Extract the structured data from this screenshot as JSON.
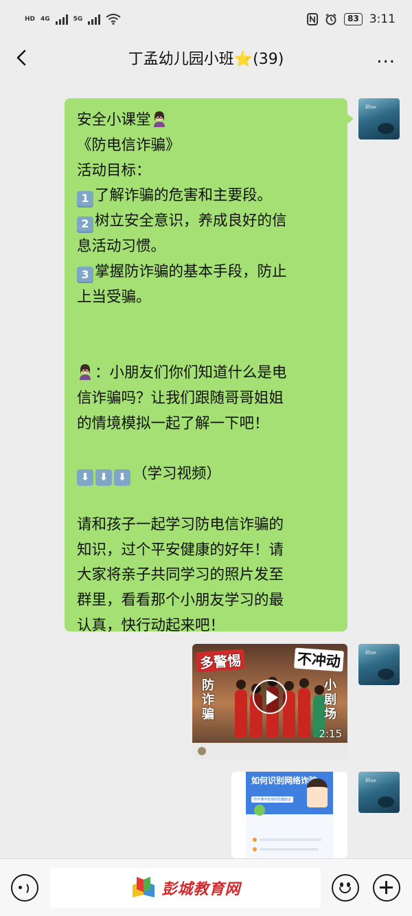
{
  "status_bar": {
    "left_badges": [
      "HD",
      "4G",
      "5G"
    ],
    "battery": "83",
    "time": "3:11"
  },
  "nav": {
    "title": "丁孟幼儿园小班⭐(39)",
    "more": "..."
  },
  "messages": {
    "text_lines": [
      {
        "text": "安全小课堂",
        "emoji": "teacher"
      },
      {
        "text": "《防电信诈骗》"
      },
      {
        "text": "活动目标："
      },
      {
        "num": "1",
        "text": "了解诈骗的危害和主要段。"
      },
      {
        "num": "2",
        "text": "树立安全意识，养成良好的信"
      },
      {
        "text": "息活动习惯。"
      },
      {
        "num": "3",
        "text": "掌握防诈骗的基本手段，防止"
      },
      {
        "text": "上当受骗。"
      },
      {
        "text": ""
      },
      {
        "text": ""
      },
      {
        "emoji": "teacher",
        "text": "：小朋友们你们知道什么是电"
      },
      {
        "text": "信诈骗吗？让我们跟随哥哥姐姐"
      },
      {
        "text": "的情境模拟一起了解一下吧！"
      },
      {
        "text": ""
      },
      {
        "arrows": 3,
        "text": "（学习视频）"
      },
      {
        "text": ""
      },
      {
        "text": "请和孩子一起学习防电信诈骗的"
      },
      {
        "text": "知识，过个平安健康的好年！请"
      },
      {
        "text": "大家将亲子共同学习的照片发至"
      },
      {
        "text": "群里，看看那个小朋友学习的最"
      },
      {
        "text": "认真，快行动起来吧！"
      }
    ],
    "video": {
      "banner_left": "多警惕",
      "banner_right": "不冲动",
      "side_left": "防诈骗",
      "side_right": "小剧场",
      "duration": "2:15"
    },
    "image": {
      "title": "如何识别网络诈骗",
      "subtitle": "你不懂不知道的防骗知识"
    }
  },
  "bottom_bar": {
    "watermark": "彭城教育网"
  },
  "colors": {
    "bubble": "#a4e074",
    "background": "#ededed",
    "logo_red": "#d3282b"
  }
}
